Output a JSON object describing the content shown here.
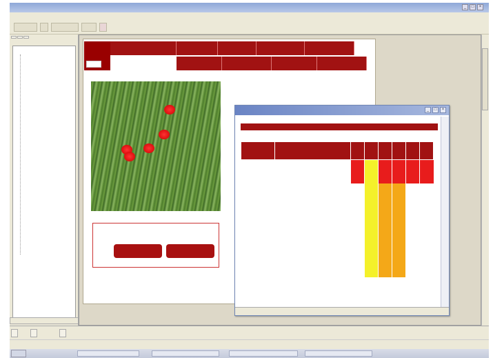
{
  "window": {
    "title": ""
  },
  "menubar": {
    "items": [
      "",
      "",
      "",
      ""
    ]
  },
  "toolbar": {
    "buttons": [
      "",
      "",
      ""
    ]
  },
  "left_panel": {
    "tabs": [
      "",
      "",
      ""
    ],
    "tree": [
      "",
      "",
      "",
      "",
      "",
      "",
      "",
      "",
      "",
      "",
      "",
      "",
      "",
      "",
      "",
      "",
      "",
      "",
      "",
      "",
      "",
      "",
      "",
      "",
      "",
      "",
      "",
      "",
      ""
    ]
  },
  "web_page": {
    "logo_text": "",
    "nav_row1": [
      "",
      "",
      "",
      "",
      "",
      ""
    ],
    "nav_row2": [
      "",
      "",
      "",
      "",
      ""
    ],
    "section_title": "",
    "subheading": "",
    "selection_label": "",
    "button_left": "",
    "button_right": ""
  },
  "popup": {
    "title": "",
    "header": "",
    "columns": [
      "",
      "",
      "",
      "",
      "",
      "",
      "",
      ""
    ],
    "rows": [
      {
        "name": "",
        "product": "",
        "cells": [
          "",
          "",
          "",
          "",
          "",
          ""
        ],
        "colors": [
          "red",
          "yellow",
          "red",
          "red",
          "red",
          "red"
        ]
      },
      {
        "name": "",
        "product": "",
        "cells": [
          "",
          "",
          "",
          "",
          "",
          ""
        ],
        "colors": [
          "white",
          "yellow",
          "orange",
          "orange",
          "white",
          "white"
        ]
      },
      {
        "name": "",
        "product": "",
        "cells": [
          "",
          "",
          "",
          "",
          "",
          ""
        ],
        "colors": [
          "white",
          "yellow",
          "orange",
          "orange",
          "white",
          "white"
        ]
      },
      {
        "name": "",
        "product": "",
        "cells": [
          "",
          "",
          "",
          "",
          "",
          ""
        ],
        "colors": [
          "white",
          "yellow",
          "orange",
          "orange",
          "white",
          "white"
        ]
      },
      {
        "name": "",
        "product": "",
        "cells": [
          "",
          "",
          "",
          "",
          "",
          ""
        ],
        "colors": [
          "white",
          "yellow",
          "orange",
          "orange",
          "white",
          "white"
        ]
      }
    ],
    "status_left": "",
    "status_right": ""
  },
  "bottom_tabs": [
    "",
    "",
    ""
  ],
  "taskbar": {
    "start_label": "",
    "items": [
      "",
      "",
      "",
      ""
    ],
    "clock": ""
  },
  "colors": {
    "brand_red": "#a11212",
    "cell_red": "#e81c1c",
    "cell_yellow": "#f4f12a",
    "cell_orange": "#f4a818"
  }
}
